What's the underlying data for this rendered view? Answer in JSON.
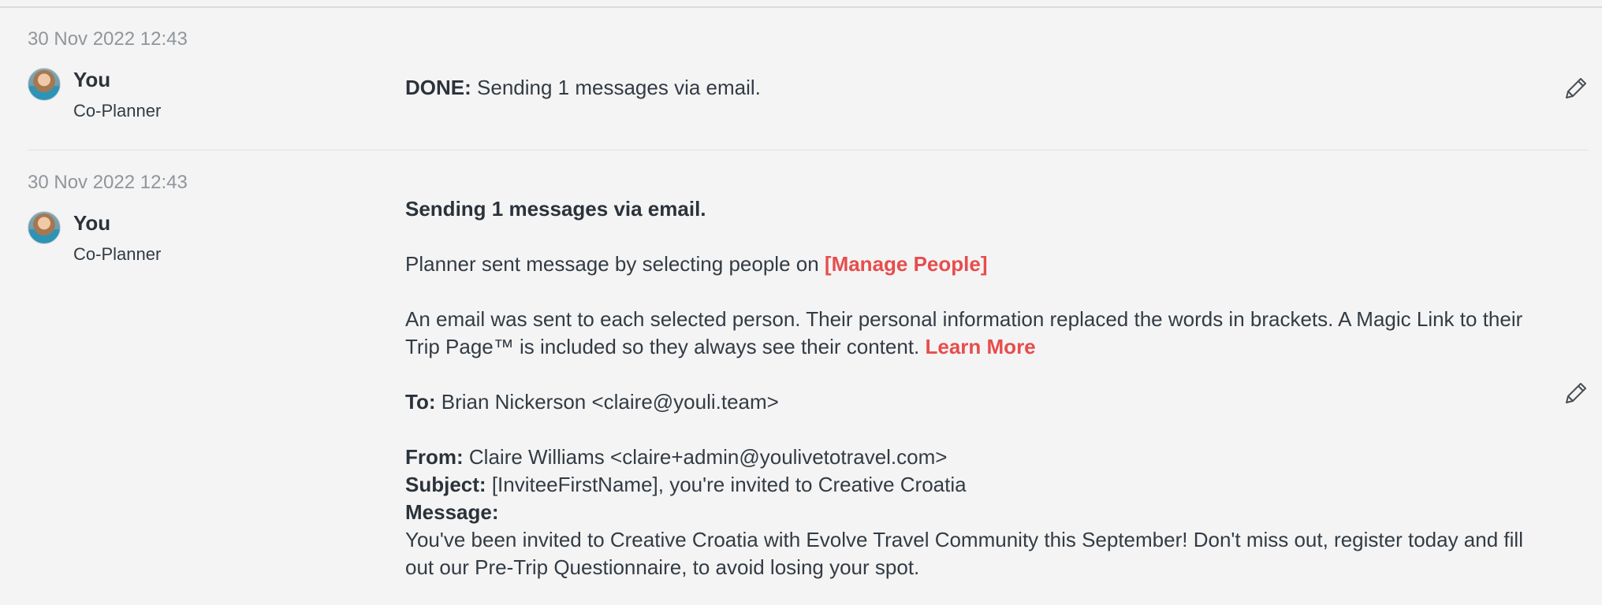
{
  "entries": [
    {
      "timestamp": "30 Nov 2022 12:43",
      "author": {
        "name": "You",
        "role": "Co-Planner",
        "avatar_icon": "user-avatar"
      },
      "status_prefix": "DONE:",
      "status_text": "Sending 1 messages via email.",
      "edit_icon": "pencil-icon"
    },
    {
      "timestamp": "30 Nov 2022 12:43",
      "author": {
        "name": "You",
        "role": "Co-Planner",
        "avatar_icon": "user-avatar"
      },
      "heading": "Sending 1 messages via email.",
      "sent_line_prefix": "Planner sent message by selecting people on",
      "manage_people_link": "[Manage People]",
      "info_text": "An email was sent to each selected person. Their personal information replaced the words in brackets. A Magic Link to their Trip Page™ is included so they always see their content.",
      "learn_more_link": "Learn More",
      "to_label": "To:",
      "to_value": "Brian Nickerson <claire@youli.team>",
      "from_label": "From:",
      "from_value": "Claire Williams <claire+admin@youlivetotravel.com>",
      "subject_label": "Subject:",
      "subject_value": "[InviteeFirstName], you're invited to Creative Croatia",
      "message_label": "Message:",
      "message_value": "You've been invited to Creative Croatia with Evolve Travel Community this September! Don't miss out, register today and fill out our Pre-Trip Questionnaire, to avoid losing your spot.",
      "edit_icon": "pencil-icon"
    }
  ],
  "colors": {
    "accent_link": "#e74d4d",
    "text": "#333b44",
    "muted": "#8f969c",
    "background": "#f4f4f4"
  }
}
